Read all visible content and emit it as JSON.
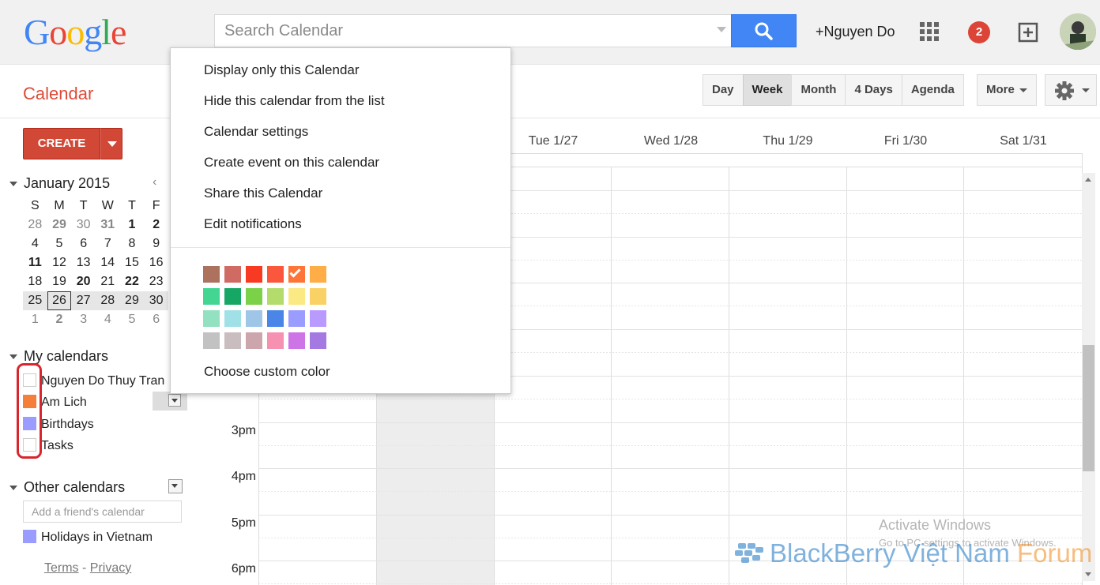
{
  "header": {
    "logo": [
      "G",
      "o",
      "o",
      "g",
      "l",
      "e"
    ],
    "logo_colors": [
      "#4285f4",
      "#ea4335",
      "#fbbc05",
      "#4285f4",
      "#34a853",
      "#ea4335"
    ],
    "search_placeholder": "Search Calendar",
    "user_name": "+Nguyen Do",
    "notification_count": "2"
  },
  "subheader": {
    "title": "Calendar",
    "views": [
      "Day",
      "Week",
      "Month",
      "4 Days",
      "Agenda"
    ],
    "active_view": "Week",
    "more_label": "More"
  },
  "sidebar": {
    "create_label": "CREATE",
    "mini_calendar": {
      "month_label": "January 2015",
      "nav_prev": "‹",
      "weekdays": [
        "S",
        "M",
        "T",
        "W",
        "T",
        "F"
      ],
      "weeks": [
        [
          "28",
          "29",
          "30",
          "31",
          "1",
          "2"
        ],
        [
          "4",
          "5",
          "6",
          "7",
          "8",
          "9"
        ],
        [
          "11",
          "12",
          "13",
          "14",
          "15",
          "16"
        ],
        [
          "18",
          "19",
          "20",
          "21",
          "22",
          "23"
        ],
        [
          "25",
          "26",
          "27",
          "28",
          "29",
          "30"
        ],
        [
          "1",
          "2",
          "3",
          "4",
          "5",
          "6"
        ]
      ]
    },
    "my_calendars_label": "My calendars",
    "my_calendars": [
      {
        "name": "Nguyen Do Thuy Tran",
        "color": "#ffffff"
      },
      {
        "name": "Am Lich",
        "color": "#f57f3a"
      },
      {
        "name": "Birthdays",
        "color": "#9a9cff"
      },
      {
        "name": "Tasks",
        "color": "#ffffff"
      }
    ],
    "other_calendars_label": "Other calendars",
    "friend_placeholder": "Add a friend's calendar",
    "other_calendars": [
      {
        "name": "Holidays in Vietnam",
        "color": "#9a9cff"
      }
    ],
    "footer": {
      "terms": "Terms",
      "separator": "-",
      "privacy": "Privacy"
    }
  },
  "grid": {
    "day_headers": [
      "Tue 1/27",
      "Wed 1/28",
      "Thu 1/29",
      "Fri 1/30",
      "Sat 1/31"
    ],
    "hours": [
      "3pm",
      "4pm",
      "5pm",
      "6pm"
    ]
  },
  "context_menu": {
    "items": [
      "Display only this Calendar",
      "Hide this calendar from the list",
      "Calendar settings",
      "Create event on this calendar",
      "Share this Calendar",
      "Edit notifications"
    ],
    "colors": [
      [
        "#ac725e",
        "#d06b64",
        "#f83a22",
        "#fa573c",
        "#ff7537",
        "#ffad46"
      ],
      [
        "#42d692",
        "#16a765",
        "#7bd148",
        "#b3dc6c",
        "#fbe983",
        "#fad165"
      ],
      [
        "#92e1c0",
        "#9fe1e7",
        "#9fc6e7",
        "#4986e7",
        "#9a9cff",
        "#b99aff"
      ],
      [
        "#c2c2c2",
        "#cabdbf",
        "#cca6ac",
        "#f691b2",
        "#cd74e6",
        "#a47ae2"
      ]
    ],
    "selected_color": "#ff7537",
    "custom_color_label": "Choose custom color"
  },
  "watermark": {
    "activate_title": "Activate Windows",
    "activate_sub": "Go to PC settings to activate Windows.",
    "forum_a": "BlackBerry Việt Nam ",
    "forum_b": "Forum"
  }
}
